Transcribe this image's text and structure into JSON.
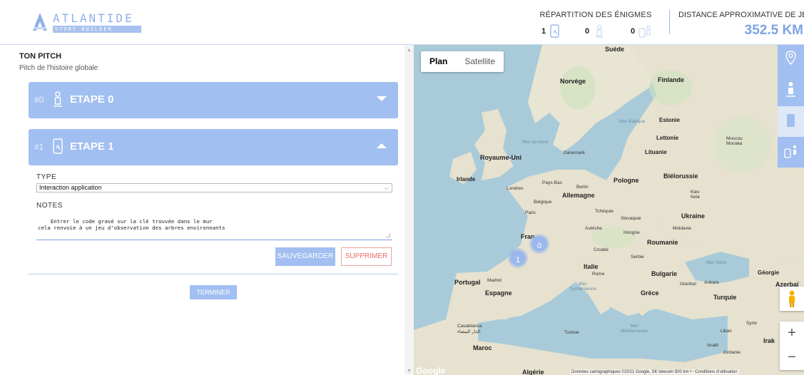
{
  "header": {
    "logo_title": "ATLANTIDE",
    "logo_subtitle": "STORY BUILDER",
    "distribution_title": "RÉPARTITION DES ÉNIGMES",
    "distribution_counts": [
      "1",
      "0",
      "0"
    ],
    "distance_title": "DISTANCE APPROXIMATIVE DE JEU",
    "distance_value": "352.5 KM"
  },
  "pitch": {
    "title": "TON PITCH",
    "subtitle": "Pitch de l'histoire globale"
  },
  "steps": [
    {
      "number": "#0",
      "label": "ETAPE 0",
      "icon": "person-pin-icon",
      "expanded": false
    },
    {
      "number": "#1",
      "label": "ETAPE 1",
      "icon": "phone-app-icon",
      "expanded": true
    }
  ],
  "step_form": {
    "type_label": "TYPE",
    "type_value": "Interaction application",
    "notes_label": "NOTES",
    "notes_value": "Entrer le code gravé sur la clé trouvée dans le mur\ncela renvoie à un jeu d'observation des arbres environnants",
    "save_label": "SAUVEGARDER",
    "delete_label": "SUPPRIMER"
  },
  "finish_label": "TERMINER",
  "map": {
    "type_options": [
      "Plan",
      "Satellite"
    ],
    "selected_type": "Plan",
    "clusters": [
      "0",
      "1"
    ],
    "places": {
      "suede": "Suède",
      "norvege": "Norvège",
      "finlande": "Finlande",
      "estonie": "Estonie",
      "lettonie": "Lettonie",
      "lituanie": "Lituanie",
      "moscou": "Moscou\nМосква",
      "mer_baltique": "Mer Baltique",
      "mer_du_nord": "Mer du Nord",
      "danemark": "Danemark",
      "royaume_uni": "Royaume-Uni",
      "irlande": "Irlande",
      "londres": "Londres",
      "pays_bas": "Pays-Bas",
      "berlin": "Berlin",
      "allemagne": "Allemagne",
      "pologne": "Pologne",
      "bielorussie": "Biélorussie",
      "kiev": "Kiev\nКиїв",
      "belgique": "Belgique",
      "paris": "Paris",
      "tcheque": "Tchéquie",
      "slovaquie": "Slovaquie",
      "ukraine": "Ukraine",
      "france": "Fran",
      "autriche": "Autriche",
      "hongrie": "Hongrie",
      "moldavie": "Moldavie",
      "roumanie": "Roumanie",
      "croatie": "Croatie",
      "serbie": "Serbie",
      "italie": "Italie",
      "rome": "Rome",
      "bulgarie": "Bulgarie",
      "mer_noire": "Mer Noire",
      "georgie": "Géorgie",
      "portugal": "Portugal",
      "madrid": "Madrid",
      "espagne": "Espagne",
      "mer_tyrrhenienne": "Mer\nTyrrhénienne",
      "grece": "Grèce",
      "istanbul": "Istanbul",
      "ankara": "Ankara",
      "turquie": "Turquie",
      "casablanca": "Casablanca\nالدار البيضاء",
      "tunisie": "Tunisie",
      "mer_mediterranee": "Mer\nMéditerranée",
      "syrie": "Syrie",
      "liban": "Liban",
      "irak": "Irak",
      "israel": "Israël",
      "jordanie": "Jordanie",
      "maroc": "Maroc",
      "algerie": "Algérie",
      "azerbaidjan": "Azerbaï"
    },
    "google_label": "Google",
    "attribution": "Données cartographiques ©2021 Google, SK telecom    500 km ⊢       Conditions d'utilisation",
    "zoom_in": "+",
    "zoom_out": "−"
  },
  "colors": {
    "accent": "#a1bff0",
    "accent_dark": "#7fa4e6",
    "danger": "#ec6b6b",
    "water": "#a9cbd9",
    "land": "#e6e2cf"
  }
}
